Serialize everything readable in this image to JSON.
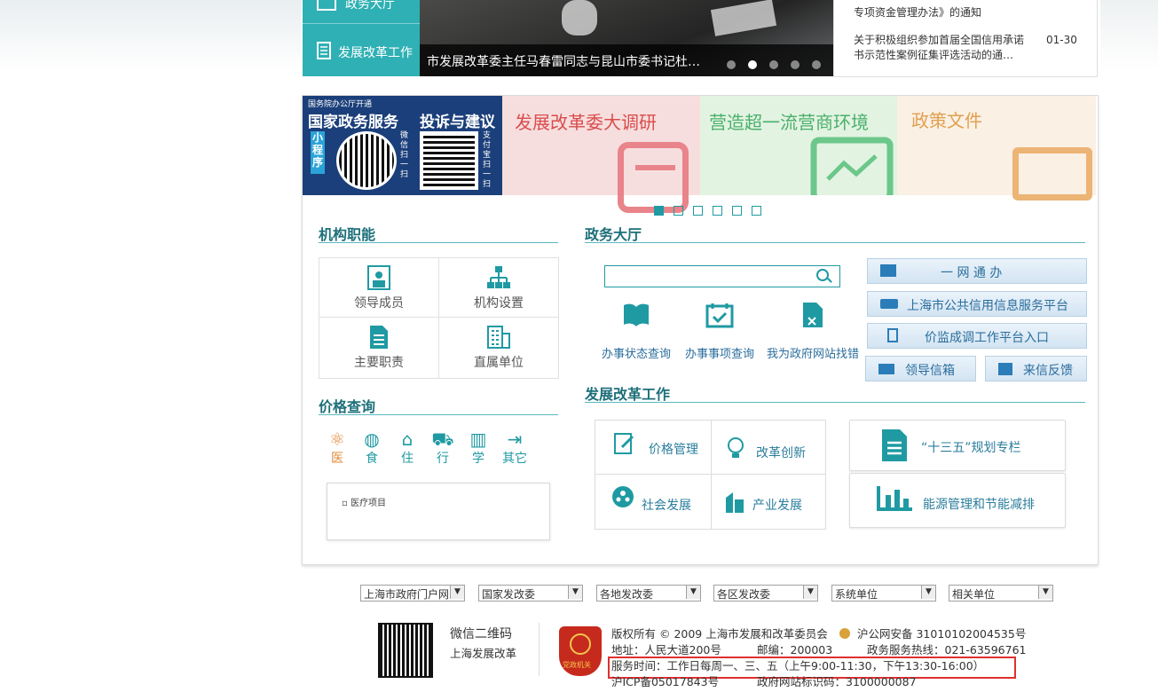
{
  "top": {
    "left_buttons": [
      "政务大厅",
      "发展改革工作"
    ],
    "slide_caption": "市发展改革委主任马春雷同志与昆山市委书记杜…",
    "slide_dots": 5,
    "slide_active_dot": 2,
    "news": [
      {
        "title": "专项资金管理办法》的通知",
        "date": ""
      },
      {
        "title": "关于积极组织参加首届全国信用承诺书示范性案例征集评选活动的通…",
        "date": "01-30"
      }
    ]
  },
  "banners": {
    "b1": {
      "top": "国务院办公厅开通",
      "title1": "国家政务服务",
      "title2": "投诉与建议",
      "mini": "小程序",
      "wechat": "微信扫一扫",
      "alipay": "支付宝扫一扫"
    },
    "b2": "发展改革委大调研",
    "b3": "营造超一流营商环境",
    "b4": "政策文件",
    "dots": 6,
    "active_dot": 1
  },
  "jigou": {
    "title": "机构职能",
    "items": [
      "领导成员",
      "机构设置",
      "主要职责",
      "直属单位"
    ]
  },
  "jiage": {
    "title": "价格查询",
    "tabs": [
      "医",
      "食",
      "住",
      "行",
      "学",
      "其它"
    ],
    "active_tab": "医",
    "list": [
      "医疗项目"
    ]
  },
  "zhengwu": {
    "title": "政务大厅",
    "search_placeholder": "",
    "quick": [
      "办事状态查询",
      "办事事项查询",
      "我为政府网站找错"
    ],
    "links": [
      "一 网 通 办",
      "上海市公共信用信息服务平台",
      "价监成调工作平台入口"
    ],
    "mail": [
      "领导信箱",
      "来信反馈"
    ]
  },
  "fazhan": {
    "title": "发展改革工作",
    "grid": [
      "价格管理",
      "改革创新",
      "社会发展",
      "产业发展"
    ],
    "big": [
      "“十三五”规划专栏",
      "能源管理和节能减排"
    ]
  },
  "selects": [
    "上海市政府门户网",
    "国家发改委",
    "各地发改委",
    "各区发改委",
    "系统单位",
    "相关单位"
  ],
  "footer": {
    "qr_title": "微信二维码",
    "qr_sub": "上海发展改革",
    "badge": "党政机关",
    "copyright": "版权所有 © 2009 上海市发展和改革委员会",
    "police": "沪公网安备 31010102004535号",
    "address": "地址：人民大道200号",
    "postcode": "邮编：200003",
    "hotline": "政务服务热线：021-63596761",
    "hours": "服务时间：工作日每周一、三、五（上午9:00-11:30，下午13:30-16:00）",
    "icp": "沪ICP备05017843号",
    "site_id": "政府网站标识码：3100000087"
  },
  "colors": {
    "teal": "#1f9aa3",
    "highlight": "#e03030",
    "navy": "#1b3f7a"
  }
}
